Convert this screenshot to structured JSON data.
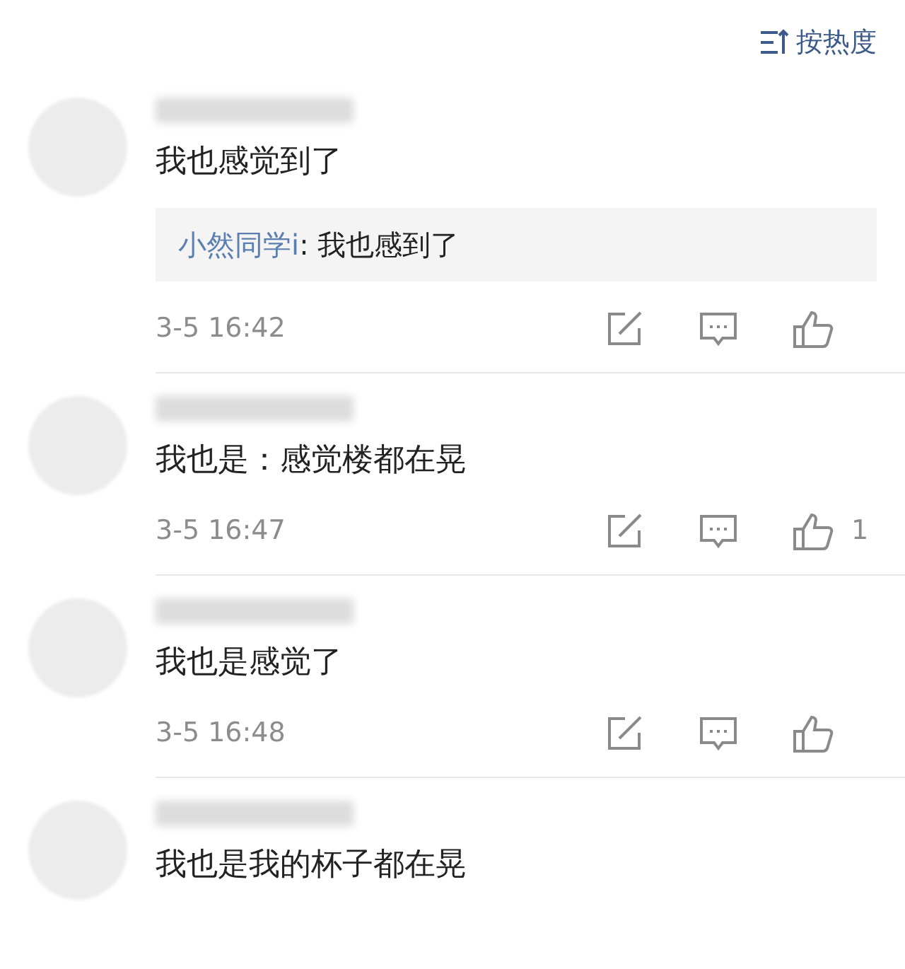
{
  "sort": {
    "label": "按热度"
  },
  "comments": [
    {
      "text": "我也感觉到了",
      "reply": {
        "author": "小然同学i",
        "text": ": 我也感到了"
      },
      "time": "3-5 16:42"
    },
    {
      "text": "我也是：感觉楼都在晃",
      "time": "3-5 16:47",
      "likes": "1"
    },
    {
      "text": "我也是感觉了",
      "time": "3-5 16:48"
    },
    {
      "text": "我也是我的杯子都在晃"
    }
  ]
}
